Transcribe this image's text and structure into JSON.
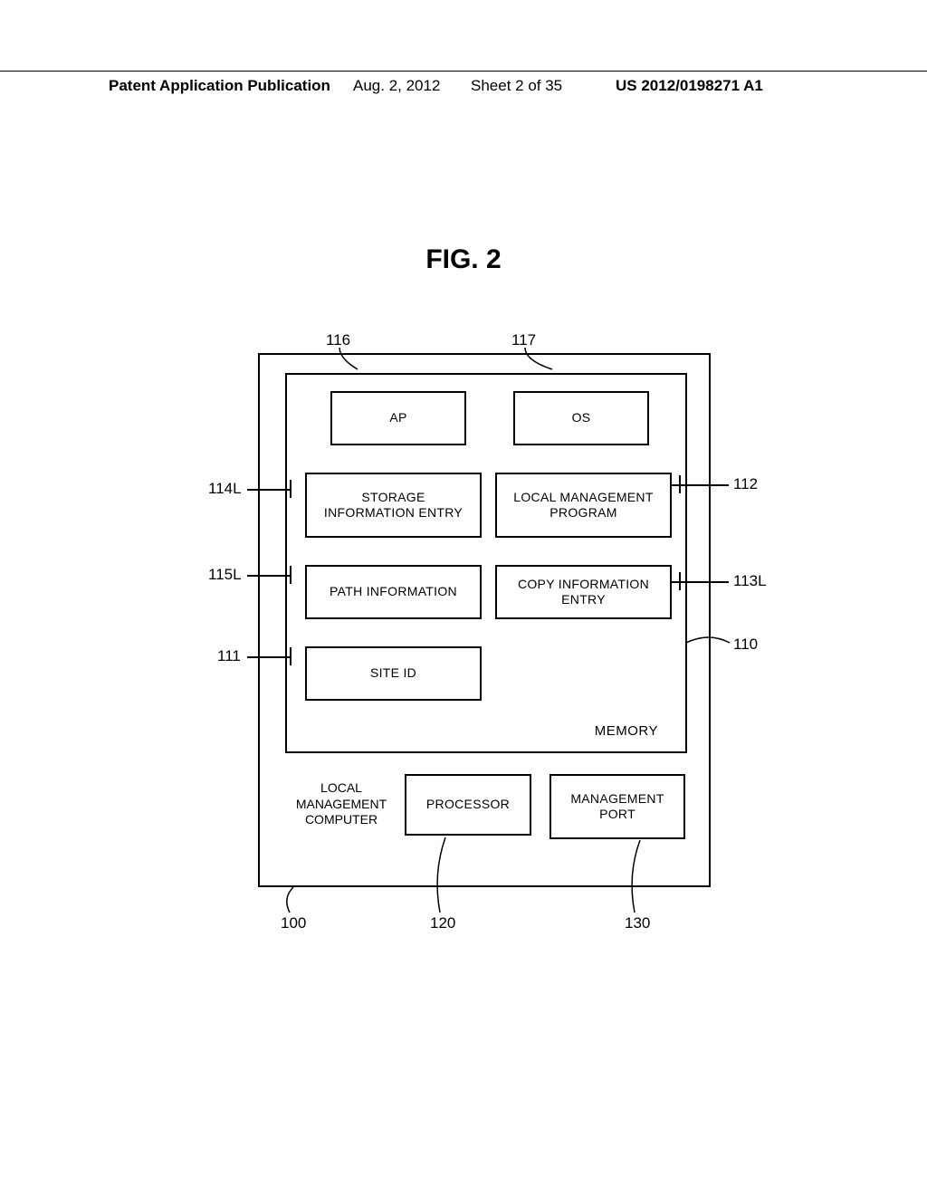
{
  "header": {
    "left": "Patent Application Publication",
    "date": "Aug. 2, 2012",
    "sheet": "Sheet 2 of 35",
    "pubno": "US 2012/0198271 A1"
  },
  "figure": {
    "title": "FIG. 2"
  },
  "blocks": {
    "ap": "AP",
    "os": "OS",
    "storage": "STORAGE\nINFORMATION ENTRY",
    "lmp": "LOCAL MANAGEMENT\nPROGRAM",
    "path": "PATH INFORMATION",
    "copy": "COPY INFORMATION\nENTRY",
    "site": "SITE ID",
    "memory": "MEMORY",
    "processor": "PROCESSOR",
    "mport": "MANAGEMENT\nPORT",
    "lmc": "LOCAL\nMANAGEMENT\nCOMPUTER"
  },
  "refs": {
    "r116": "116",
    "r117": "117",
    "r114L": "114L",
    "r112": "112",
    "r115L": "115L",
    "r113L": "113L",
    "r110": "110",
    "r111": "111",
    "r100": "100",
    "r120": "120",
    "r130": "130"
  }
}
